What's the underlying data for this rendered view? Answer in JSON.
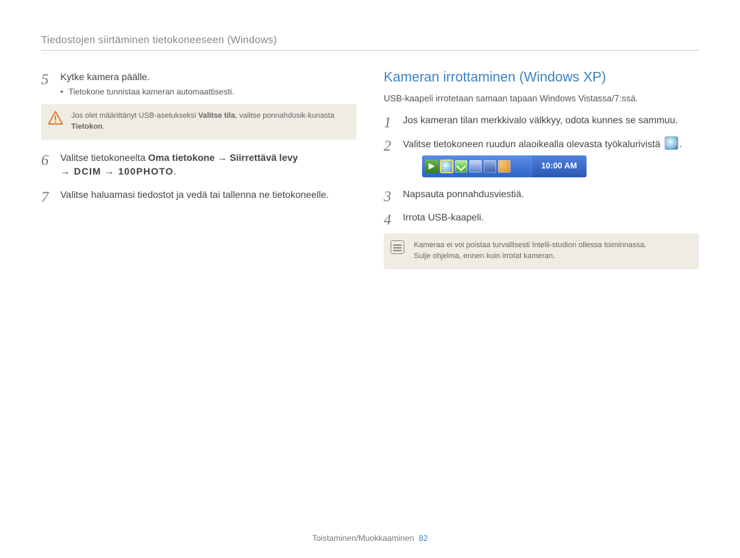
{
  "header": {
    "title": "Tiedostojen siirtäminen tietokoneeseen (Windows)"
  },
  "left": {
    "start": 4,
    "steps": [
      {
        "text": "Kytke kamera päälle.",
        "sub": "Tietokone tunnistaa kameran automaattisesti."
      },
      {
        "rich": {
          "pre": "Valitse tietokoneelta ",
          "bold1": "Oma tietokone",
          "arrow1": " → ",
          "bold2": "Siirrettävä levy",
          "line2_arrow1": "→ ",
          "bold3": "DCIM",
          "arrow2": " → ",
          "bold4": "100PHOTO",
          "period": "."
        }
      },
      {
        "text": "Valitse haluamasi tiedostot ja vedä tai tallenna ne tietokoneelle."
      }
    ],
    "warning": {
      "pre": "Jos olet määrittänyt USB-asetukseksi ",
      "bold1": "Valitse tila",
      "mid": ", valitse ponnahdusik-kunasta ",
      "bold2": "Tietokon",
      "post": "."
    }
  },
  "right": {
    "title": "Kameran irrottaminen (Windows XP)",
    "intro": "USB-kaapeli irrotetaan samaan tapaan Windows Vistassa/7:ssä.",
    "steps": [
      {
        "text": "Jos kameran tilan merkkivalo välkkyy, odota kunnes se sammuu."
      },
      {
        "text_a": "Valitse tietokoneen ruudun alaoikealla olevasta työkalurivistä ",
        "text_b": "."
      },
      {
        "text": "Napsauta ponnahdusviestiä."
      },
      {
        "text": "Irrota USB-kaapeli."
      }
    ],
    "taskbar": {
      "clock": "10:00 AM"
    },
    "note": {
      "line1": "Kameraa ei voi poistaa turvallisesti Intelli-studion ollessa toiminnassa.",
      "line2": "Sulje ohjelma, ennen kuin irrotat kameran."
    }
  },
  "footer": {
    "section": "Toistaminen/Muokkaaminen",
    "page": "82"
  }
}
